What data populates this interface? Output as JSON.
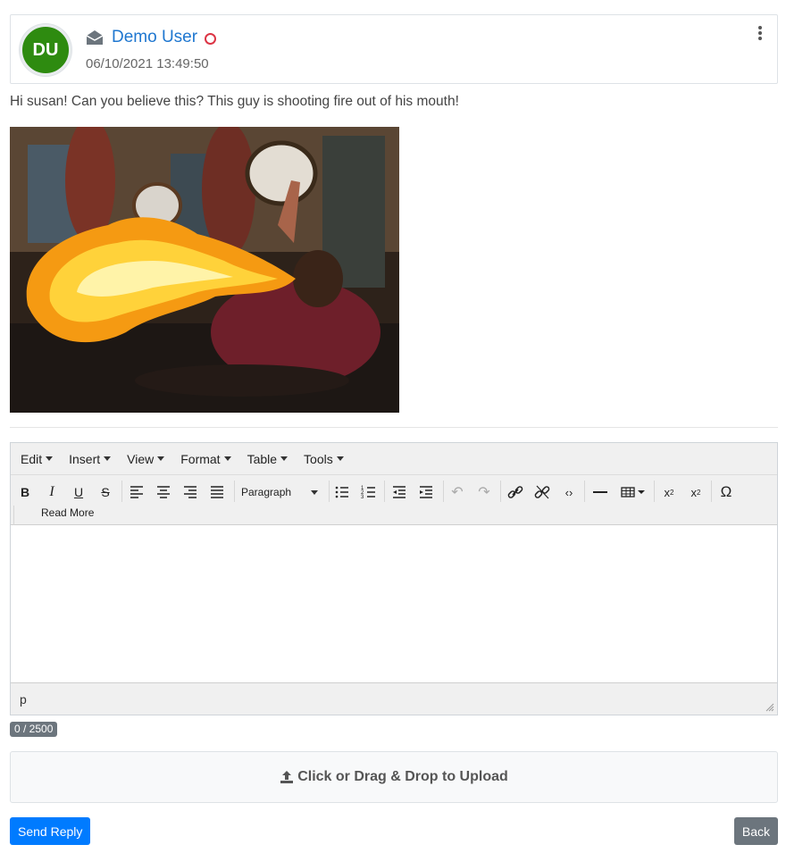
{
  "message": {
    "avatar_initials": "DU",
    "sender_name": "Demo User",
    "timestamp": "06/10/2021 13:49:50",
    "body": "Hi susan! Can you believe this? This guy is shooting fire out of his mouth!"
  },
  "editor": {
    "menus": [
      "Edit",
      "Insert",
      "View",
      "Format",
      "Table",
      "Tools"
    ],
    "paragraph_select": "Paragraph",
    "read_more_label": "Read More",
    "path": "p"
  },
  "char_count": "0 / 2500",
  "upload": {
    "label": "Click or Drag & Drop to Upload"
  },
  "actions": {
    "send_label": "Send Reply",
    "back_label": "Back"
  },
  "colors": {
    "avatar": "#2e8b10",
    "link": "#1f77d0",
    "primary": "#007bff",
    "secondary": "#6c757d",
    "status": "#dc3545"
  }
}
